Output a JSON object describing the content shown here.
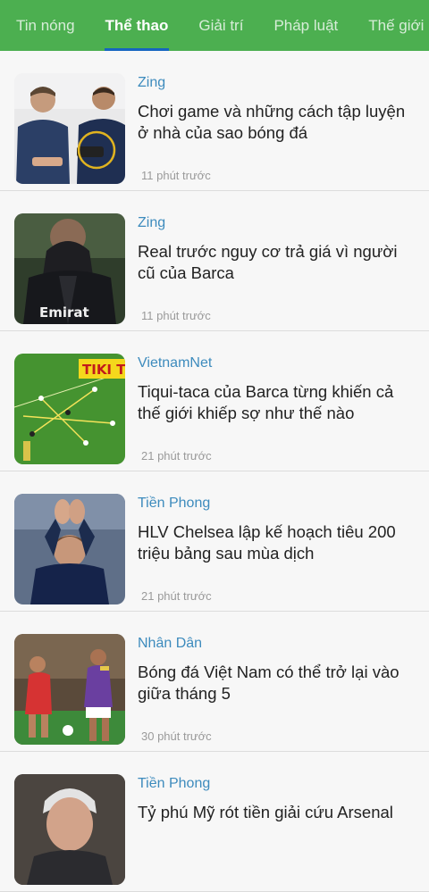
{
  "tabs": [
    {
      "label": "Tin nóng",
      "active": false
    },
    {
      "label": "Thể thao",
      "active": true
    },
    {
      "label": "Giải trí",
      "active": false
    },
    {
      "label": "Pháp luật",
      "active": false
    },
    {
      "label": "Thế giới",
      "active": false
    }
  ],
  "colors": {
    "accent": "#4caf50",
    "source": "#3d8bbd",
    "indicator": "#1565c0"
  },
  "articles": [
    {
      "source": "Zing",
      "title": "Chơi game và những cách tập luyện ở nhà của sao bóng đá",
      "time": "11 phút trước",
      "thumb_icon": "footballers-gaming-photo"
    },
    {
      "source": "Zing",
      "title": "Real trước nguy cơ trả giá vì người cũ của Barca",
      "time": "11 phút trước",
      "thumb_icon": "player-face-in-hands-photo",
      "thumb_text": "Emirat"
    },
    {
      "source": "VietnamNet",
      "title": "Tiqui-taca của Barca từng khiến cả thế giới khiếp sợ như thế nào",
      "time": "21 phút trước",
      "thumb_icon": "football-pitch-diagram-photo",
      "thumb_text": "TIKI T"
    },
    {
      "source": "Tiền Phong",
      "title": "HLV Chelsea lập kế hoạch tiêu 200 triệu bảng sau mùa dịch",
      "time": "21 phút trước",
      "thumb_icon": "coach-applauding-photo"
    },
    {
      "source": "Nhân Dân",
      "title": "Bóng đá Việt Nam có thể trở lại vào giữa tháng 5",
      "time": "30 phút trước",
      "thumb_icon": "vietnam-football-match-photo"
    },
    {
      "source": "Tiền Phong",
      "title": "Tỷ phú Mỹ rót tiền giải cứu Arsenal",
      "time": "",
      "thumb_icon": "billionaire-portrait-photo"
    }
  ]
}
